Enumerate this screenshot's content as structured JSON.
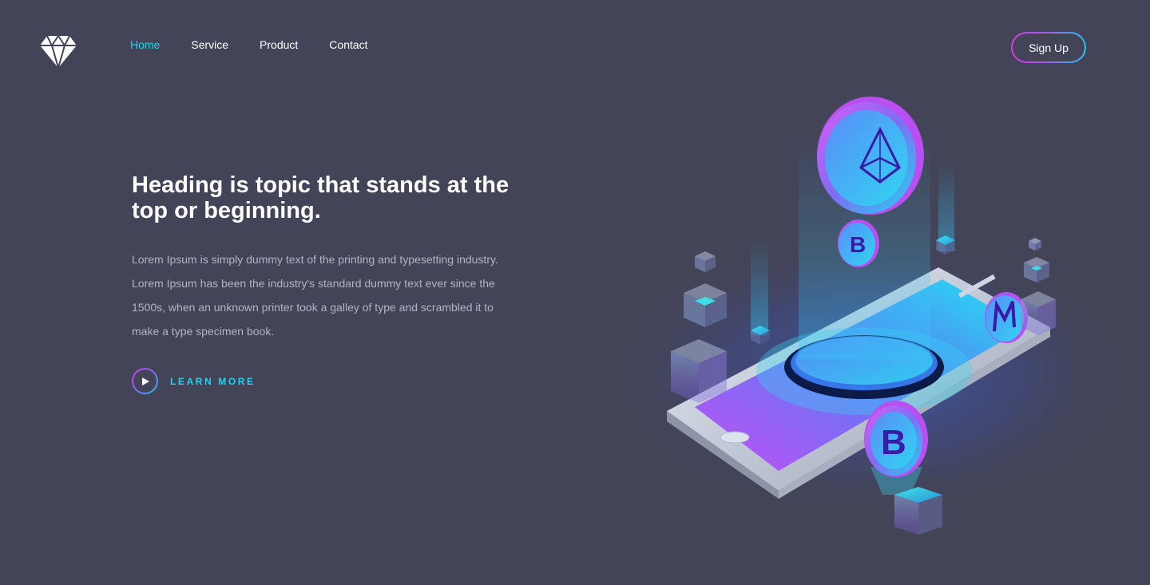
{
  "nav": {
    "items": [
      {
        "label": "Home",
        "active": true
      },
      {
        "label": "Service",
        "active": false
      },
      {
        "label": "Product",
        "active": false
      },
      {
        "label": "Contact",
        "active": false
      }
    ]
  },
  "header": {
    "logo_icon": "diamond-icon",
    "signup_label": "Sign Up"
  },
  "hero": {
    "title": "Heading is topic that stands at the top or beginning.",
    "description": "Lorem Ipsum is simply dummy text of the printing and typesetting industry. Lorem Ipsum has been the industry's standard dummy text ever since the 1500s, when an unknown printer took a galley of type and scrambled it to make a type specimen book.",
    "cta_label": "LEARN MORE",
    "cta_icon": "play-icon"
  },
  "illustration": {
    "icon": "crypto-phone-illustration",
    "coins": [
      "ethereum-coin-icon",
      "bitcoin-coin-icon",
      "monero-coin-icon",
      "bitcoin-coin-icon"
    ]
  },
  "colors": {
    "background": "#434458",
    "accent": "#22d3ee",
    "gradient_start": "#d63ae6",
    "gradient_end": "#22c7ee",
    "body_text": "#b3b4c1"
  }
}
